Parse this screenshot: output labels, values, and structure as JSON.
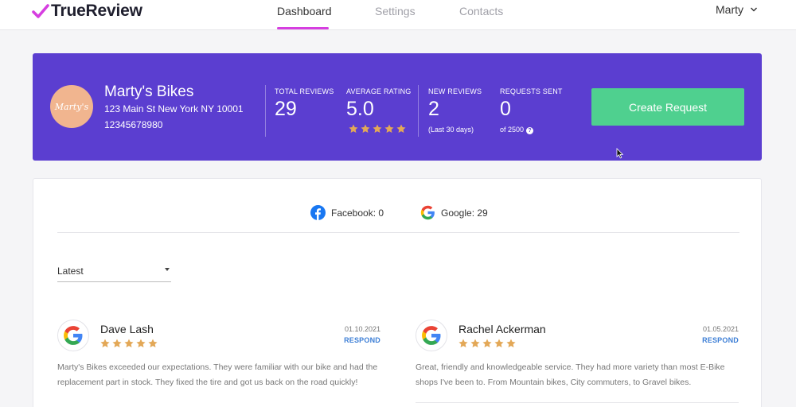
{
  "app": {
    "name": "TrueReview"
  },
  "nav": {
    "tabs": [
      {
        "label": "Dashboard",
        "active": true
      },
      {
        "label": "Settings",
        "active": false
      },
      {
        "label": "Contacts",
        "active": false
      }
    ],
    "user": "Marty",
    "accent_color": "#d63ee0"
  },
  "business": {
    "avatar_text": "Marty's",
    "name": "Marty's Bikes",
    "address": "123 Main St New York NY 10001",
    "phone": "12345678980"
  },
  "stats": {
    "total_reviews": {
      "label": "TOTAL REVIEWS",
      "value": "29"
    },
    "average_rating": {
      "label": "AVERAGE RATING",
      "value": "5.0",
      "stars": 5
    },
    "new_reviews": {
      "label": "NEW REVIEWS",
      "value": "2",
      "sub": "(Last 30 days)"
    },
    "requests_sent": {
      "label": "REQUESTS SENT",
      "value": "0",
      "sub": "of 2500",
      "help_icon": "?"
    }
  },
  "create_request_label": "Create Request",
  "colors": {
    "banner": "#5b3ed0",
    "button": "#4fd08f",
    "star": "#e3a857",
    "link": "#3d7fd6"
  },
  "sources": [
    {
      "icon": "facebook-icon",
      "label": "Facebook: 0"
    },
    {
      "icon": "google-icon",
      "label": "Google: 29"
    }
  ],
  "sort": {
    "value": "Latest"
  },
  "reviews": [
    {
      "name": "Dave Lash",
      "stars": 5,
      "date": "01.10.2021",
      "action": "RESPOND",
      "text": "Marty's Bikes exceeded our expectations. They were familiar with our bike and had the replacement part in stock. They fixed the tire and got us back on the road quickly!"
    },
    {
      "name": "Rachel Ackerman",
      "stars": 5,
      "date": "01.05.2021",
      "action": "RESPOND",
      "text": "Great, friendly and knowledgeable service. They had more variety than most E-Bike shops I've been to. From Mountain bikes, City commuters, to Gravel bikes."
    }
  ]
}
